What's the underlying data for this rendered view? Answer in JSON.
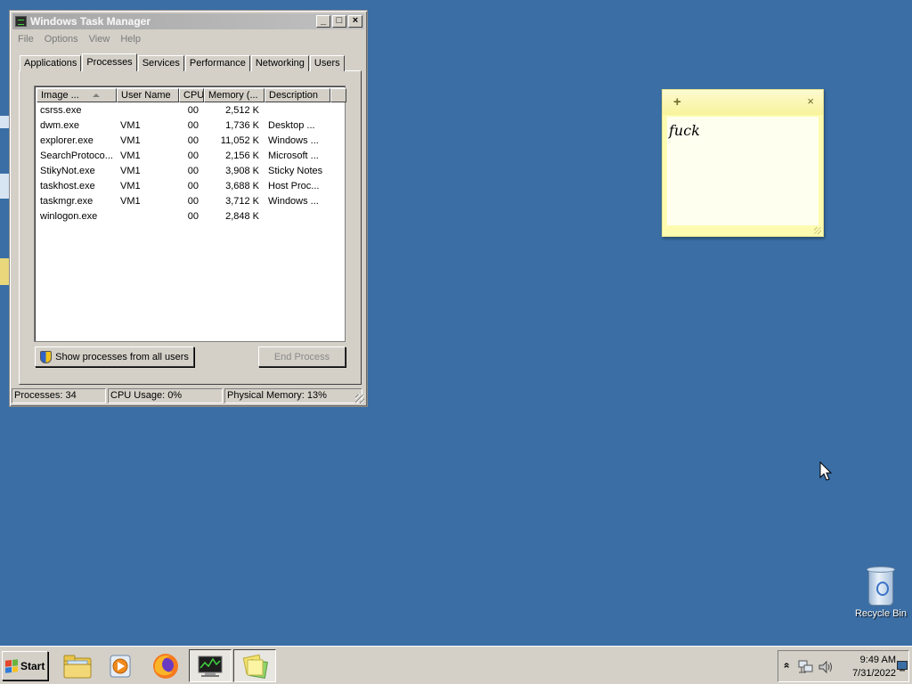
{
  "task_manager": {
    "title": "Windows Task Manager",
    "menu": [
      "File",
      "Options",
      "View",
      "Help"
    ],
    "tabs": [
      "Applications",
      "Processes",
      "Services",
      "Performance",
      "Networking",
      "Users"
    ],
    "active_tab": "Processes",
    "columns": [
      "Image ...",
      "User Name",
      "CPU",
      "Memory (...",
      "Description"
    ],
    "processes": [
      {
        "image": "csrss.exe",
        "user": "",
        "cpu": "00",
        "memory": "2,512 K",
        "description": ""
      },
      {
        "image": "dwm.exe",
        "user": "VM1",
        "cpu": "00",
        "memory": "1,736 K",
        "description": "Desktop ..."
      },
      {
        "image": "explorer.exe",
        "user": "VM1",
        "cpu": "00",
        "memory": "11,052 K",
        "description": "Windows ..."
      },
      {
        "image": "SearchProtoco...",
        "user": "VM1",
        "cpu": "00",
        "memory": "2,156 K",
        "description": "Microsoft ..."
      },
      {
        "image": "StikyNot.exe",
        "user": "VM1",
        "cpu": "00",
        "memory": "3,908 K",
        "description": "Sticky Notes"
      },
      {
        "image": "taskhost.exe",
        "user": "VM1",
        "cpu": "00",
        "memory": "3,688 K",
        "description": "Host Proc..."
      },
      {
        "image": "taskmgr.exe",
        "user": "VM1",
        "cpu": "00",
        "memory": "3,712 K",
        "description": "Windows ..."
      },
      {
        "image": "winlogon.exe",
        "user": "",
        "cpu": "00",
        "memory": "2,848 K",
        "description": ""
      }
    ],
    "show_all_button": "Show processes from all users",
    "end_process_button": "End Process",
    "status": {
      "processes": "Processes: 34",
      "cpu": "CPU Usage: 0%",
      "memory": "Physical Memory: 13%"
    }
  },
  "sticky_note": {
    "text": "fuck",
    "add_glyph": "+",
    "close_glyph": "×"
  },
  "desktop": {
    "recycle_bin_label": "Recycle Bin",
    "background_color": "#3a6ea5"
  },
  "taskbar": {
    "start_label": "Start",
    "apps": [
      "folder-icon",
      "media-player-icon",
      "firefox-icon",
      "task-manager-icon",
      "sticky-notes-icon"
    ],
    "clock_time": "9:49 AM",
    "clock_date": "7/31/2022",
    "tray_expand_glyph": "»"
  }
}
